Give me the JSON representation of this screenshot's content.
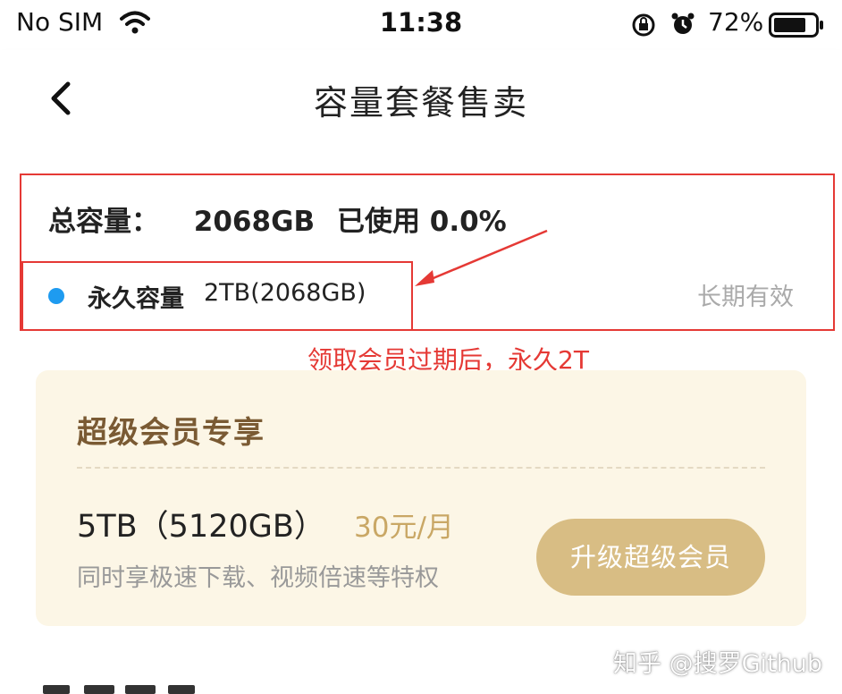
{
  "status_bar": {
    "carrier": "No SIM",
    "time": "11:38",
    "battery_percent": "72%",
    "icons": [
      "wifi-icon",
      "orientation-lock-icon",
      "alarm-icon",
      "battery-icon"
    ]
  },
  "nav": {
    "title": "容量套餐售卖",
    "back_icon": "chevron-left-icon"
  },
  "capacity": {
    "total_label": "总容量：",
    "total_value": "2068GB",
    "used_label": "已使用 0.0%",
    "plan": {
      "name": "永久容量",
      "size": "2TB(2068GB)",
      "validity": "长期有效",
      "dot_color": "#1e9bf0"
    }
  },
  "annotation": {
    "text": "领取会员过期后，永久2T",
    "color": "#e53935"
  },
  "vip": {
    "title": "超级会员专享",
    "size": "5TB（5120GB）",
    "price": "30元/月",
    "description": "同时享极速下载、视频倍速等特权",
    "upgrade_button": "升级超级会员",
    "accent_color": "#d8bd84"
  },
  "watermark": "知乎 @搜罗Github"
}
